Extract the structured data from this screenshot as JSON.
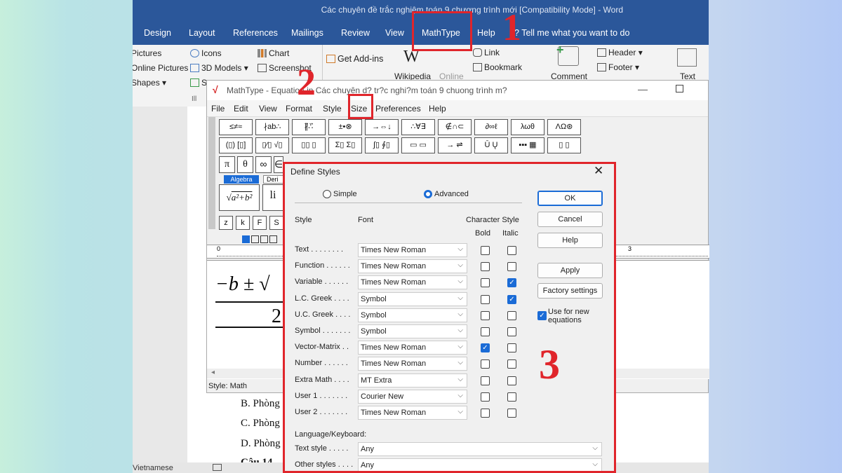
{
  "word": {
    "title": "Các chuyên đề trắc nghiệm toán 9 chương trình mới [Compatibility Mode]  -  Word",
    "tabs": [
      "Design",
      "Layout",
      "References",
      "Mailings",
      "Review",
      "View",
      "MathType",
      "Help",
      "Tell me what you want to do"
    ],
    "ribbon": {
      "pictures": "Pictures",
      "online_pictures": "Online Pictures",
      "shapes": "Shapes",
      "icons": "Icons",
      "models": "3D Models",
      "smartart": "S",
      "chart": "Chart",
      "screenshot": "Screenshot",
      "get_addins": "Get Add-ins",
      "wikipedia": "Wikipedia",
      "online": "Online",
      "link": "Link",
      "bookmark": "Bookmark",
      "comment": "Comment",
      "header": "Header",
      "footer": "Footer",
      "text": "Text",
      "ill": "Ill"
    },
    "doc_lines": [
      "B. Phòng",
      "C. Phòng",
      "D. Phòng",
      "Câu 14"
    ],
    "status_lang": "Vietnamese"
  },
  "mathtype": {
    "title": "MathType - Equation in Các chuyên d? tr?c nghi?m toán 9 chuong trình m?",
    "menu": [
      "File",
      "Edit",
      "View",
      "Format",
      "Style",
      "Size",
      "Preferences",
      "Help"
    ],
    "palette_row1": [
      "≤≠≈",
      "∤ab∴",
      "∦⃗∴⃗",
      "±•⊗",
      "→⇔↓",
      "∴∀∃",
      "∉∩⊂",
      "∂∞ℓ",
      "λωθ",
      "ΛΩ⊛"
    ],
    "palette_row2": [
      "(▯) [▯]",
      "▯⁄▯ √▯",
      "▯▯ ▯",
      "Σ▯ Σ▯",
      "∫▯ ∮▯",
      "▭ ▭",
      "→ ⇌",
      "Ū Ų",
      "▪▪▪ ▦",
      "▯ ▯"
    ],
    "palette_row3": [
      "π",
      "θ",
      "∞",
      "∈"
    ],
    "tabs": [
      "Algebra",
      "Deri"
    ],
    "palette_row5": [
      "z",
      "k",
      "F",
      "S"
    ],
    "formula_num": "−b ± √",
    "formula_den": "2",
    "style_status": "Style: Math",
    "ruler_marks": [
      "0",
      "3"
    ]
  },
  "dialog": {
    "title": "Define Styles",
    "mode_simple": "Simple",
    "mode_advanced": "Advanced",
    "hdr_style": "Style",
    "hdr_font": "Font",
    "hdr_charstyle": "Character Style",
    "hdr_bold": "Bold",
    "hdr_italic": "Italic",
    "rows": [
      {
        "label": "Text . . . . . . . .",
        "font": "Times New Roman",
        "bold": false,
        "italic": false
      },
      {
        "label": "Function . . . . . .",
        "font": "Times New Roman",
        "bold": false,
        "italic": false
      },
      {
        "label": "Variable . . . . . .",
        "font": "Times New Roman",
        "bold": false,
        "italic": true
      },
      {
        "label": "L.C. Greek . . . .",
        "font": "Symbol",
        "bold": false,
        "italic": true
      },
      {
        "label": "U.C. Greek . . . .",
        "font": "Symbol",
        "bold": false,
        "italic": false
      },
      {
        "label": "Symbol . . . . . . .",
        "font": "Symbol",
        "bold": false,
        "italic": false
      },
      {
        "label": "Vector-Matrix . .",
        "font": "Times New Roman",
        "bold": true,
        "italic": false
      },
      {
        "label": "Number . . . . . .",
        "font": "Times New Roman",
        "bold": false,
        "italic": false
      },
      {
        "label": "Extra Math . . . .",
        "font": "MT Extra",
        "bold": false,
        "italic": false
      },
      {
        "label": "User 1 . . . . . . .",
        "font": "Courier New",
        "bold": false,
        "italic": false
      },
      {
        "label": "User 2 . . . . . . .",
        "font": "Times New Roman",
        "bold": false,
        "italic": false
      }
    ],
    "lang_keyboard": "Language/Keyboard:",
    "text_style_label": "Text style . . . . .",
    "text_style_value": "Any",
    "other_styles_label": "Other styles . . . .",
    "other_styles_value": "Any",
    "buttons": {
      "ok": "OK",
      "cancel": "Cancel",
      "help": "Help",
      "apply": "Apply",
      "factory": "Factory settings"
    },
    "use_new": "Use for new equations",
    "use_new_checked": true
  },
  "annotations": {
    "n1": "1",
    "n2": "2",
    "n3": "3"
  },
  "colors": {
    "accent": "#2b579a",
    "highlight": "#e0252b",
    "check": "#1a6bd6"
  }
}
